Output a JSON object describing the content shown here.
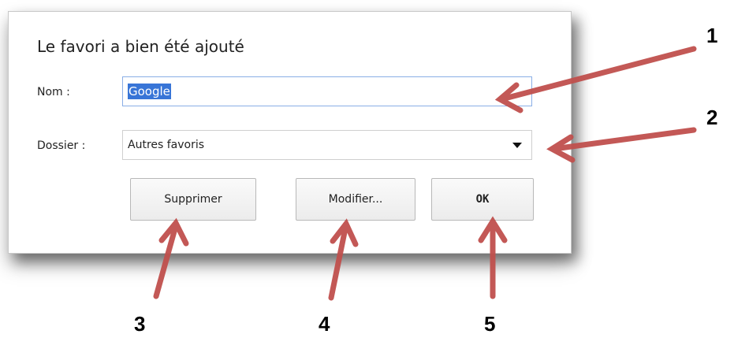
{
  "dialog": {
    "title": "Le favori a bien été ajouté",
    "name_label": "Nom :",
    "name_value": "Google",
    "folder_label": "Dossier :",
    "folder_value": "Autres favoris",
    "buttons": {
      "delete": "Supprimer",
      "edit": "Modifier...",
      "ok": "OK"
    }
  },
  "annotations": {
    "n1": "1",
    "n2": "2",
    "n3": "3",
    "n4": "4",
    "n5": "5",
    "arrow_color": "#c0504d"
  }
}
